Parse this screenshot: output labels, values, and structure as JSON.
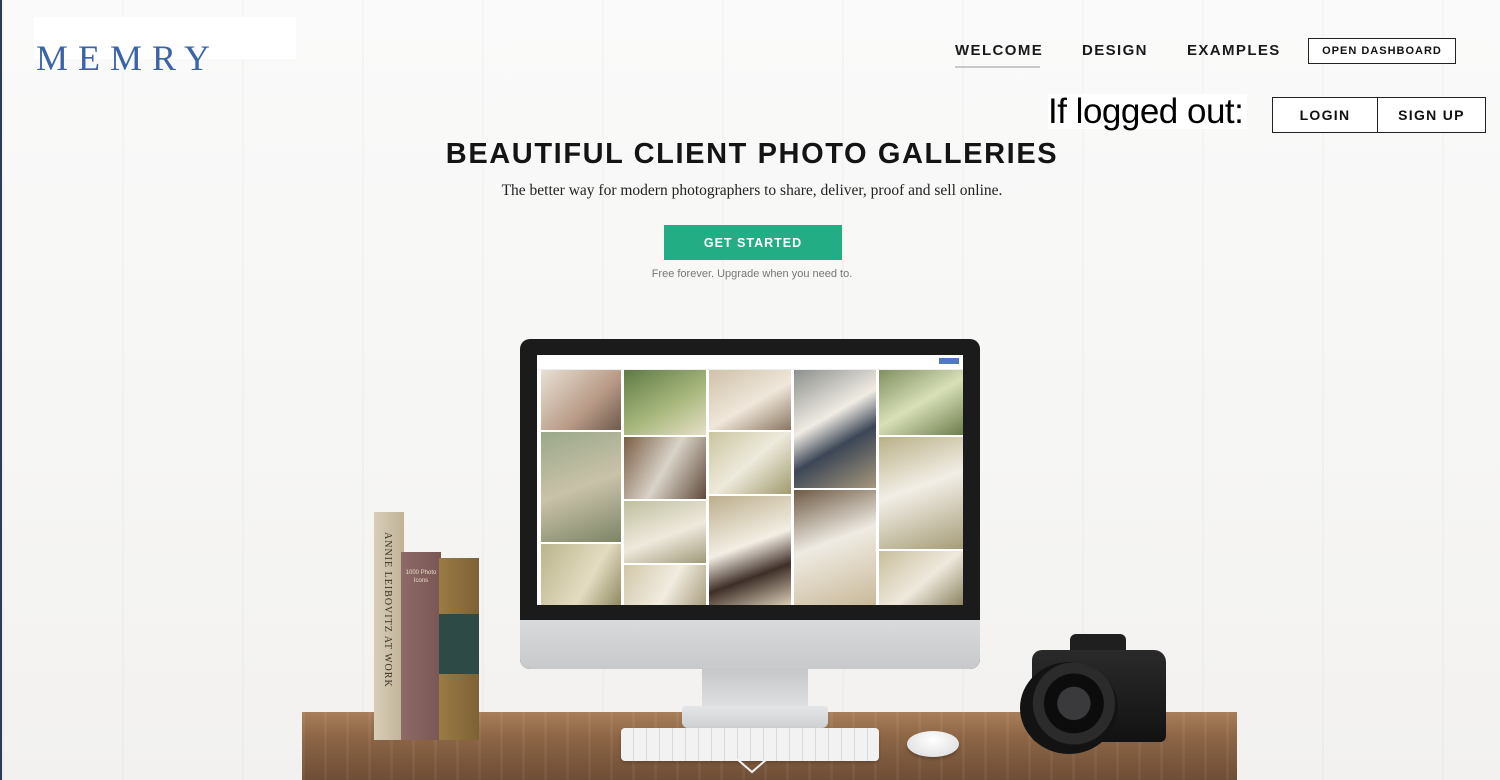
{
  "brand": {
    "logo_text": "MEMRY",
    "logo_color": "#3b64a6"
  },
  "nav": {
    "links": [
      {
        "label": "WELCOME",
        "active": true
      },
      {
        "label": "DESIGN",
        "active": false
      },
      {
        "label": "EXAMPLES",
        "active": false
      }
    ],
    "dashboard_button": "OPEN DASHBOARD"
  },
  "auth": {
    "logged_out_label": "If logged out:",
    "login_label": "LOGIN",
    "signup_label": "SIGN UP"
  },
  "hero": {
    "headline": "BEAUTIFUL CLIENT PHOTO GALLERIES",
    "subheadline": "The better way for modern photographers to share, deliver, proof and sell online.",
    "cta_label": "GET STARTED",
    "cta_color": "#22ad85",
    "cta_note": "Free forever. Upgrade when you need to."
  },
  "scene": {
    "book_spine_title": "ANNIE LEIBOVITZ AT WORK",
    "book_2_title": "1000 Photo Icons"
  },
  "icons": {
    "scroll_down": "chevron-down-icon"
  }
}
